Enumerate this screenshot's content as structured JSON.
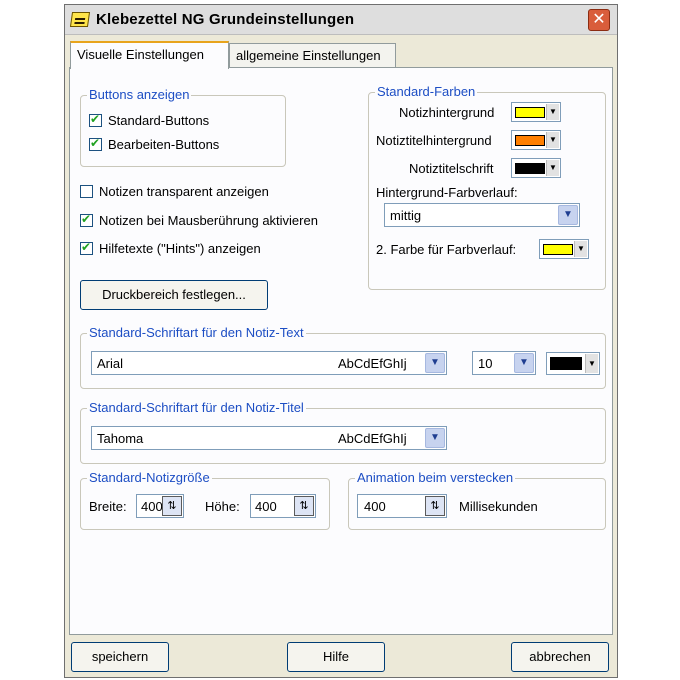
{
  "window": {
    "title": "Klebezettel NG Grundeinstellungen",
    "close_symbol": "✕"
  },
  "tabs": [
    {
      "label": "Visuelle Einstellungen",
      "active": true
    },
    {
      "label": "allgemeine Einstellungen",
      "active": false
    }
  ],
  "buttons_group": {
    "legend": "Buttons anzeigen",
    "items": [
      {
        "label": "Standard-Buttons",
        "checked": true
      },
      {
        "label": "Bearbeiten-Buttons",
        "checked": true
      }
    ]
  },
  "options": [
    {
      "label": "Notizen transparent anzeigen",
      "checked": false
    },
    {
      "label": "Notizen bei Mausberührung aktivieren",
      "checked": true
    },
    {
      "label": "Hilfetexte (\"Hints\") anzeigen",
      "checked": true
    }
  ],
  "colors_group": {
    "legend": "Standard-Farben",
    "note_background": {
      "label": "Notizhintergrund",
      "color": "#ffff00"
    },
    "title_background": {
      "label": "Notiztitelhintergrund",
      "color": "#ff7f00"
    },
    "title_font": {
      "label": "Notiztitelschrift",
      "color": "#000000"
    },
    "gradient_label": "Hintergrund-Farbverlauf:",
    "gradient_value": "mittig",
    "second_color": {
      "label": "2. Farbe für Farbverlauf:",
      "color": "#ffff00"
    }
  },
  "print_area_button": "Druckbereich festlegen...",
  "text_font_group": {
    "legend": "Standard-Schriftart für den Notiz-Text",
    "font": "Arial",
    "sample": "AbCdEfGhIj",
    "size": "10",
    "color": "#000000"
  },
  "title_font_group": {
    "legend": "Standard-Schriftart für den Notiz-Titel",
    "font": "Tahoma",
    "sample": "AbCdEfGhIj"
  },
  "size_group": {
    "legend": "Standard-Notizgröße",
    "width_label": "Breite:",
    "width_value": "400",
    "height_label": "Höhe:",
    "height_value": "400"
  },
  "animation_group": {
    "legend": "Animation beim verstecken",
    "value": "400",
    "unit": "Millisekunden"
  },
  "footer": {
    "save": "speichern",
    "help": "Hilfe",
    "cancel": "abbrechen"
  },
  "icons": {
    "dropdown": "▼",
    "spin": "⇅"
  }
}
